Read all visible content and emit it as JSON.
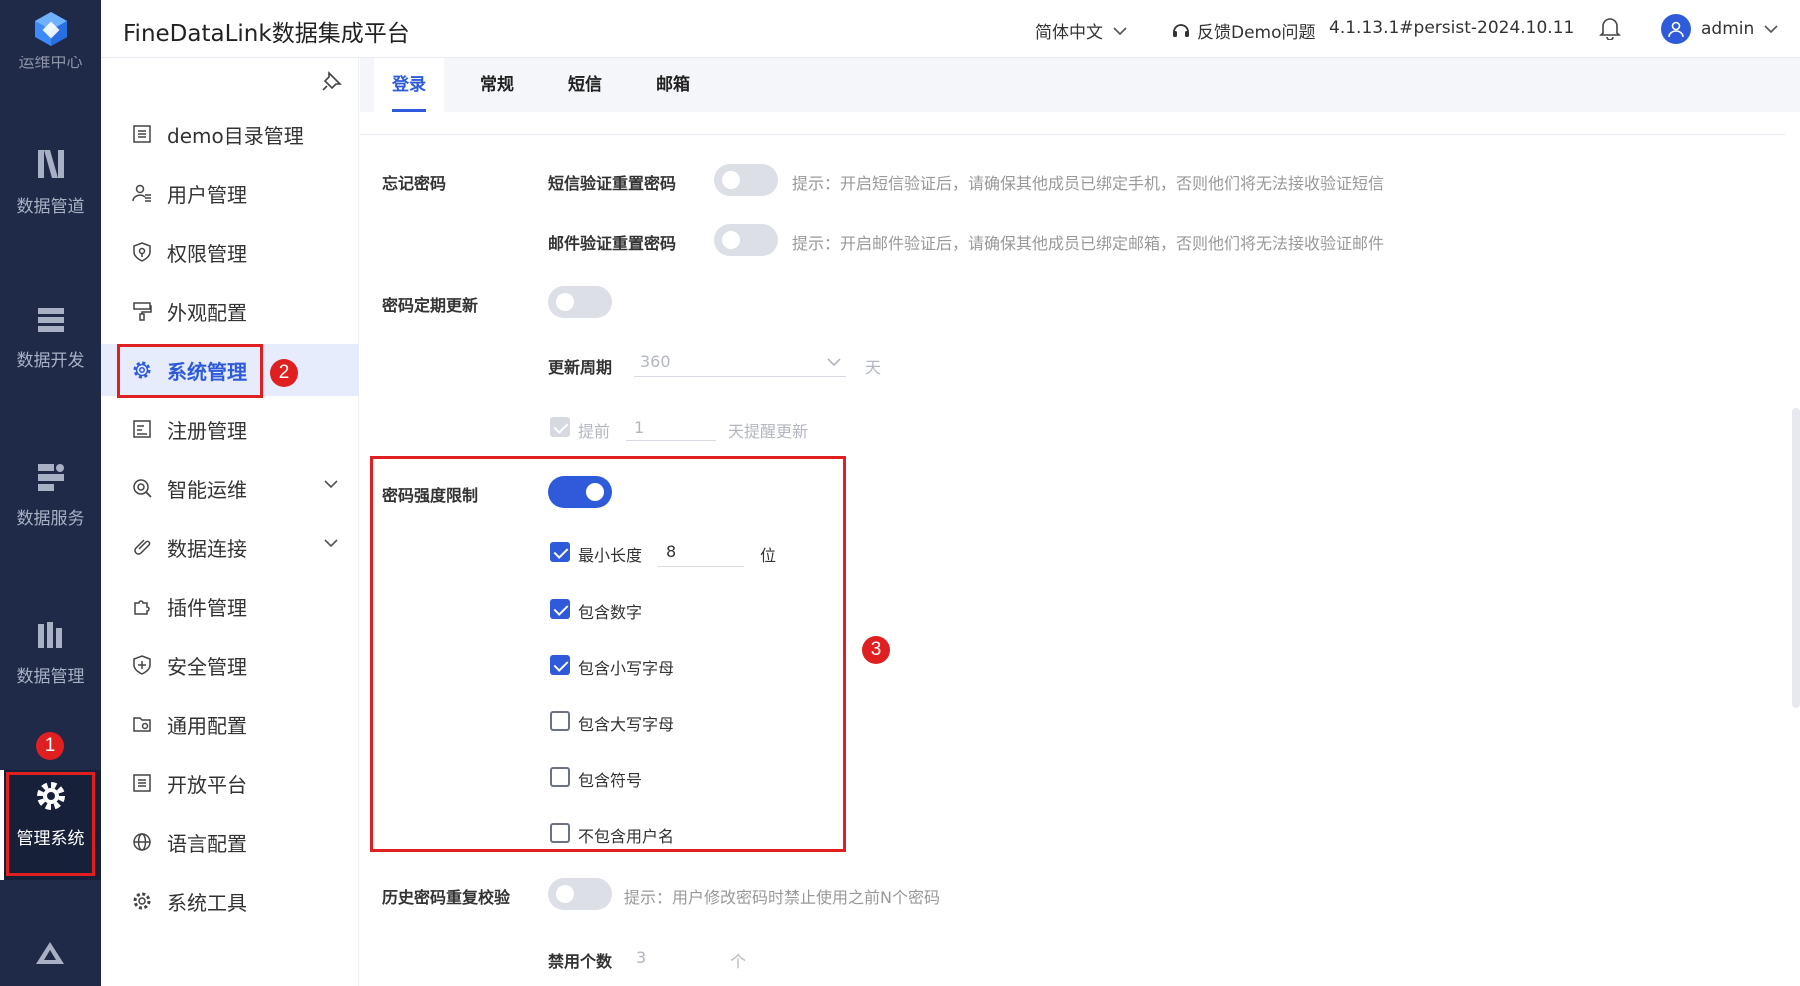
{
  "topbar": {
    "app_title": "FineDataLink数据集成平台",
    "language": "简体中文",
    "feedback": "反馈Demo问题",
    "version": "4.1.13.1#persist-2024.10.11",
    "user": "admin"
  },
  "rail": {
    "cut_label": "运维中心",
    "items": [
      {
        "label": "数据管道",
        "icon": "pipeline-icon"
      },
      {
        "label": "数据开发",
        "icon": "dev-icon"
      },
      {
        "label": "数据服务",
        "icon": "service-icon"
      },
      {
        "label": "数据管理",
        "icon": "data-manage-icon"
      },
      {
        "label": "管理系统",
        "icon": "gear-icon"
      }
    ]
  },
  "menu": {
    "items": [
      {
        "label": "demo目录管理",
        "icon": "list-icon"
      },
      {
        "label": "用户管理",
        "icon": "user-icon"
      },
      {
        "label": "权限管理",
        "icon": "shield-icon"
      },
      {
        "label": "外观配置",
        "icon": "paint-icon"
      },
      {
        "label": "系统管理",
        "icon": "gear-icon"
      },
      {
        "label": "注册管理",
        "icon": "register-icon"
      },
      {
        "label": "智能运维",
        "icon": "ops-icon"
      },
      {
        "label": "数据连接",
        "icon": "link-icon"
      },
      {
        "label": "插件管理",
        "icon": "plugin-icon"
      },
      {
        "label": "安全管理",
        "icon": "security-icon"
      },
      {
        "label": "通用配置",
        "icon": "folder-gear-icon"
      },
      {
        "label": "开放平台",
        "icon": "list-icon"
      },
      {
        "label": "语言配置",
        "icon": "globe-icon"
      },
      {
        "label": "系统工具",
        "icon": "tool-icon"
      }
    ]
  },
  "tabs": [
    "登录",
    "常规",
    "短信",
    "邮箱"
  ],
  "form": {
    "forgot_password": {
      "label": "忘记密码",
      "sms_label": "短信验证重置密码",
      "sms_hint": "提示：开启短信验证后，请确保其他成员已绑定手机，否则他们将无法接收验证短信",
      "mail_label": "邮件验证重置密码",
      "mail_hint": "提示：开启邮件验证后，请确保其他成员已绑定邮箱，否则他们将无法接收验证邮件"
    },
    "periodic_update": {
      "label": "密码定期更新",
      "cycle_label": "更新周期",
      "cycle_value": "360",
      "cycle_unit": "天",
      "advance_label": "提前",
      "advance_value": "1",
      "advance_suffix": "天提醒更新"
    },
    "strength": {
      "label": "密码强度限制",
      "min_length_label": "最小长度",
      "min_length_value": "8",
      "min_length_unit": "位",
      "options": [
        {
          "label": "包含数字",
          "checked": true
        },
        {
          "label": "包含小写字母",
          "checked": true
        },
        {
          "label": "包含大写字母",
          "checked": false
        },
        {
          "label": "包含符号",
          "checked": false
        },
        {
          "label": "不包含用户名",
          "checked": false
        }
      ]
    },
    "history": {
      "label": "历史密码重复校验",
      "hint": "提示：用户修改密码时禁止使用之前N个密码",
      "count_label": "禁用个数",
      "count_value": "3",
      "count_unit": "个"
    }
  },
  "annotations": [
    "1",
    "2",
    "3"
  ],
  "colors": {
    "accent": "#2f5bdb",
    "rail": "#1f2a48",
    "annotation": "#e02020"
  }
}
